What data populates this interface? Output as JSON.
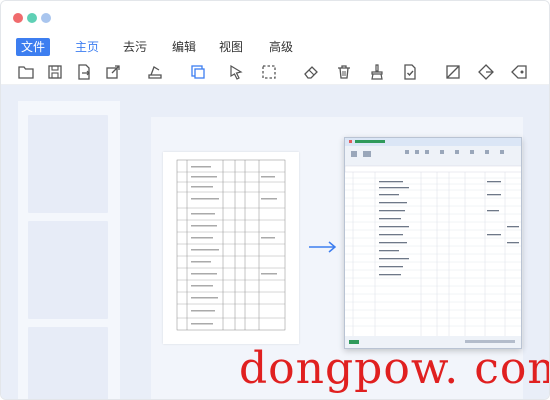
{
  "window": {
    "dot_colors": [
      "#f06b6d",
      "#5fd0b5",
      "#a9c5ee"
    ],
    "accent": "#3d7ef0"
  },
  "menu": {
    "items": [
      {
        "label": "文件",
        "state": "highlighted"
      },
      {
        "label": "主页",
        "state": "active"
      },
      {
        "label": "去污"
      },
      {
        "label": "编辑"
      },
      {
        "label": "视图"
      },
      {
        "label": "高级"
      }
    ]
  },
  "toolbar": {
    "icons": [
      "open-folder-icon",
      "save-icon",
      "export-icon",
      "share-icon",
      "scan-icon",
      "copy-icon",
      "select-pointer-icon",
      "marquee-select-icon",
      "eraser-icon",
      "delete-icon",
      "clean-brush-icon",
      "document-check-icon",
      "crop-icon",
      "erase-diamond-icon",
      "erase-tag-icon"
    ]
  },
  "watermark": {
    "text": "dongpow. com",
    "color": "#e02020"
  }
}
